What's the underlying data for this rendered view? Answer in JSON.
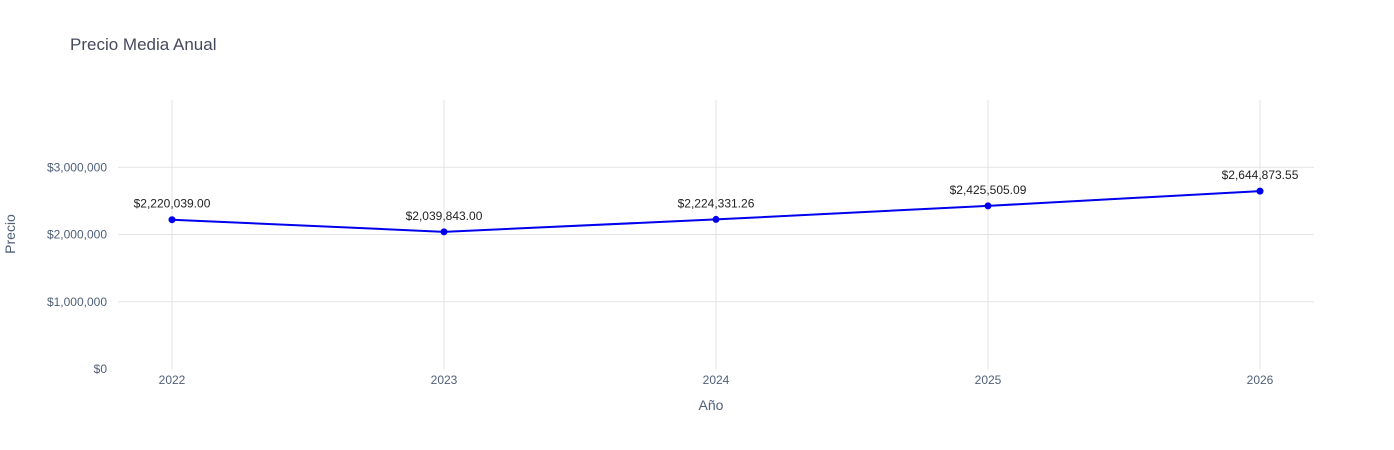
{
  "chart_data": {
    "type": "line",
    "title": "Precio Media Anual",
    "xlabel": "Año",
    "ylabel": "Precio",
    "x": [
      "2022",
      "2023",
      "2024",
      "2025",
      "2026"
    ],
    "values": [
      2220039.0,
      2039843.0,
      2224331.26,
      2425505.09,
      2644873.55
    ],
    "data_labels": [
      "$2,220,039.00",
      "$2,039,843.00",
      "$2,224,331.26",
      "$2,425,505.09",
      "$2,644,873.55"
    ],
    "y_ticks": [
      {
        "value": 0,
        "label": "$0"
      },
      {
        "value": 1000000,
        "label": "$1,000,000"
      },
      {
        "value": 2000000,
        "label": "$2,000,000"
      },
      {
        "value": 3000000,
        "label": "$3,000,000"
      }
    ],
    "ylim": [
      0,
      4000000
    ],
    "grid": true,
    "legend": false,
    "colors": {
      "line": "#0000ee",
      "marker": "#0000ee",
      "grid": "#e3e3e3",
      "axis_text": "#506079",
      "title_text": "#444a5c"
    }
  }
}
